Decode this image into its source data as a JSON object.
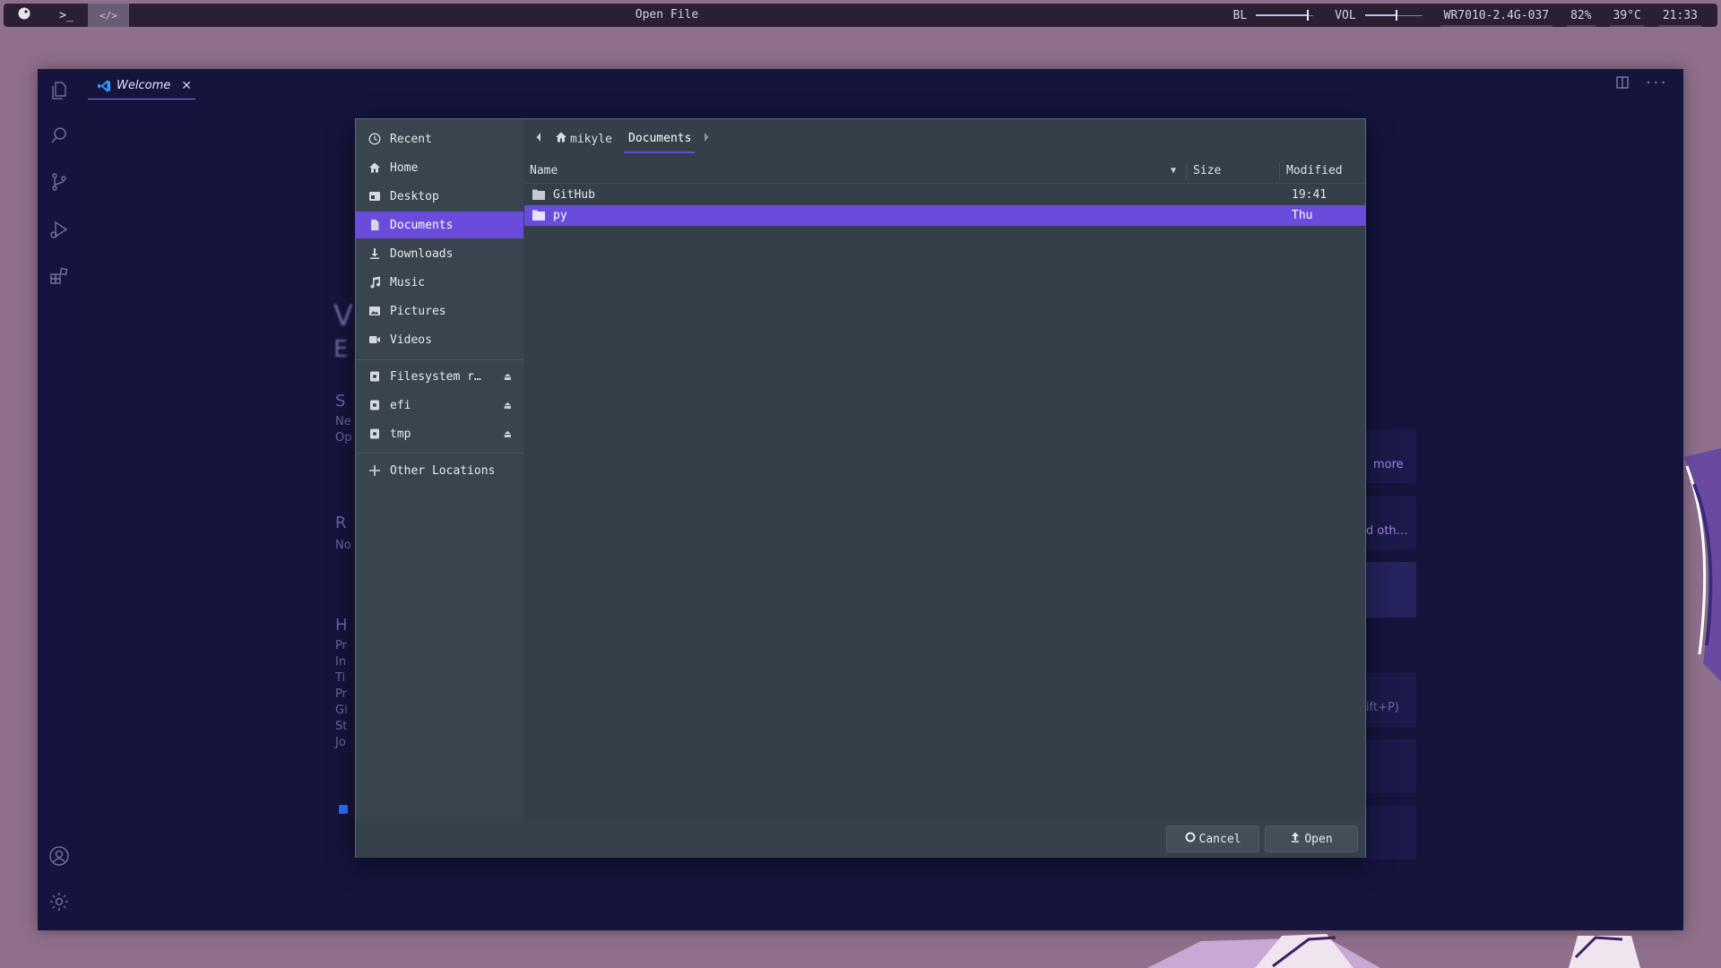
{
  "topbar": {
    "launcher_icon": "distro-logo-icon",
    "terminal_label": ">_",
    "code_label": "</>",
    "title": "Open File",
    "backlight_label": "BL",
    "backlight_level": 0.9,
    "volume_label": "VOL",
    "volume_level": 0.55,
    "wifi": "WR7010-2.4G-037",
    "battery": "82%",
    "temperature": "39°C",
    "clock": "21:33"
  },
  "vscode": {
    "tab_label": "Welcome",
    "tab_close": "✕",
    "background_color": "#15143d",
    "accent": "#7d7cff"
  },
  "welcome_bg": {
    "visible_fragments": {
      "more": "more",
      "oth": "d oth…",
      "shortcut": "ift+P)"
    }
  },
  "dialog": {
    "places": [
      {
        "label": "Recent",
        "icon": "clock-icon"
      },
      {
        "label": "Home",
        "icon": "home-icon"
      },
      {
        "label": "Desktop",
        "icon": "desktop-icon"
      },
      {
        "label": "Documents",
        "icon": "document-icon",
        "active": true
      },
      {
        "label": "Downloads",
        "icon": "download-icon"
      },
      {
        "label": "Music",
        "icon": "music-icon"
      },
      {
        "label": "Pictures",
        "icon": "picture-icon"
      },
      {
        "label": "Videos",
        "icon": "video-icon"
      }
    ],
    "devices": [
      {
        "label": "Filesystem r…",
        "icon": "drive-icon",
        "eject": "⏏"
      },
      {
        "label": "efi",
        "icon": "drive-icon",
        "eject": "⏏"
      },
      {
        "label": "tmp",
        "icon": "drive-icon",
        "eject": "⏏"
      }
    ],
    "other_locations": "Other Locations",
    "path": {
      "home": "mikyle",
      "current": "Documents"
    },
    "columns": {
      "name": "Name",
      "size": "Size",
      "modified": "Modified"
    },
    "files": [
      {
        "name": "GitHub",
        "size": "",
        "modified": "19:41",
        "selected": false
      },
      {
        "name": "py",
        "size": "",
        "modified": "Thu",
        "selected": true
      }
    ],
    "buttons": {
      "cancel": "Cancel",
      "open": "Open"
    },
    "accent": "#6a4bdc"
  }
}
